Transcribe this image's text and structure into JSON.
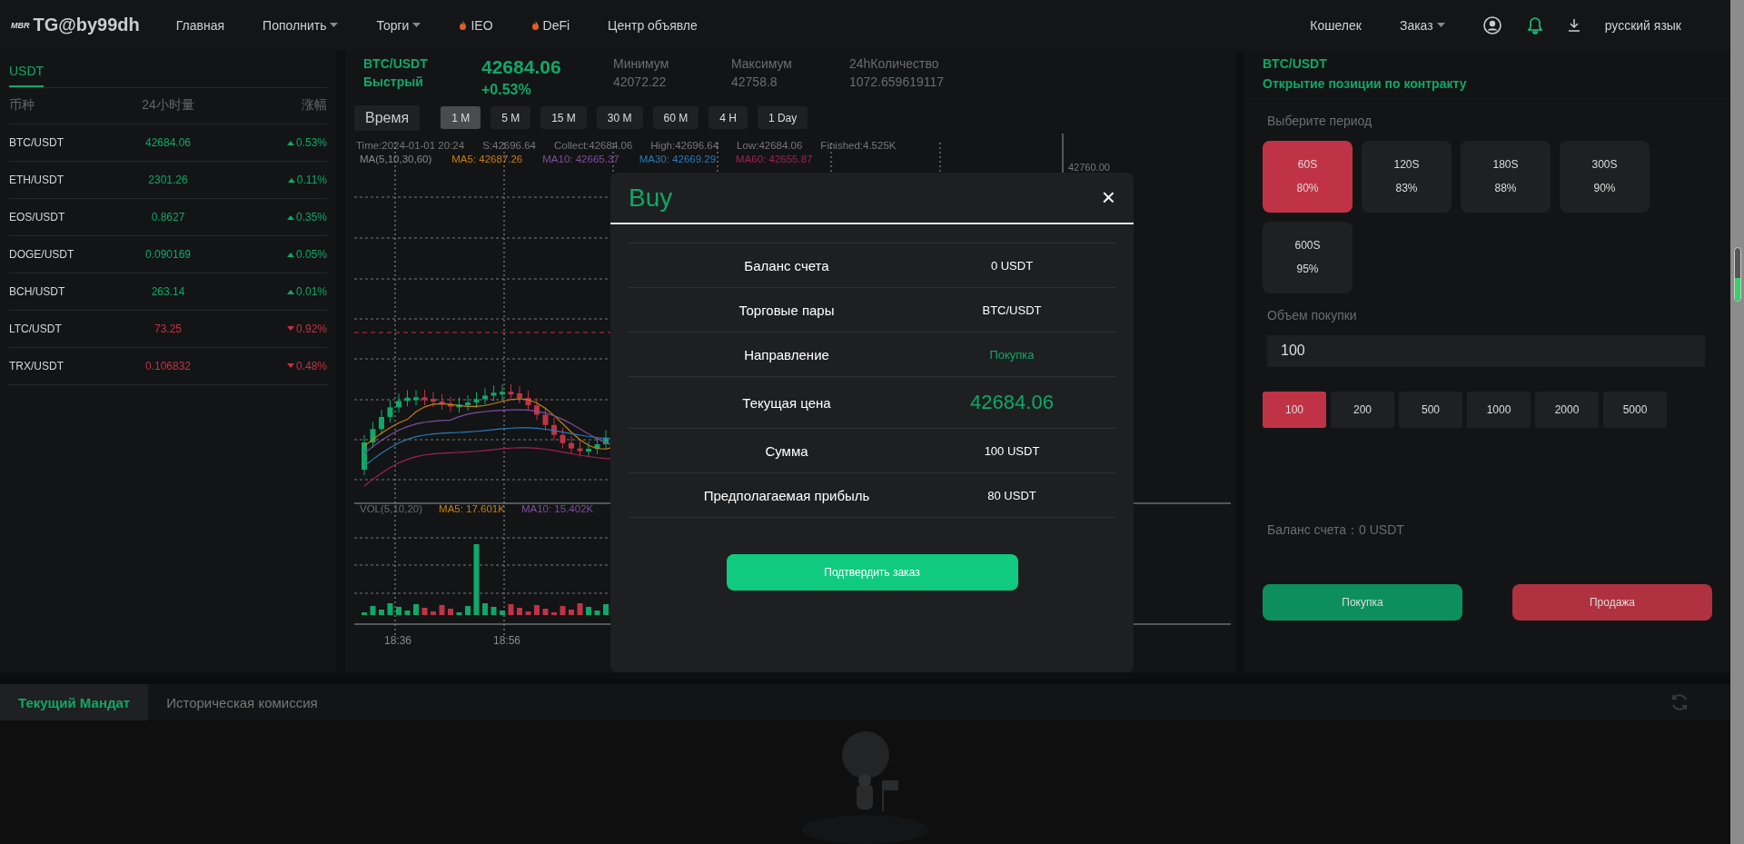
{
  "nav": {
    "logo_mark": "MBR",
    "brand": "TG@by99dh",
    "items": [
      {
        "label": "Главная",
        "kind": "plain"
      },
      {
        "label": "Пополнить",
        "kind": "dropdown"
      },
      {
        "label": "Торги",
        "kind": "dropdown"
      },
      {
        "label": "IEO",
        "kind": "fire"
      },
      {
        "label": "DeFi",
        "kind": "fire"
      },
      {
        "label": "Центр объявле",
        "kind": "plain"
      }
    ],
    "right": [
      {
        "label": "Кошелек",
        "kind": "plain"
      },
      {
        "label": "Заказ",
        "kind": "dropdown"
      },
      {
        "kind": "user"
      },
      {
        "kind": "bell"
      },
      {
        "kind": "download"
      },
      {
        "label": "русский язык",
        "kind": "plain"
      }
    ]
  },
  "market": {
    "tabs": [
      {
        "label": "USDT",
        "selected": true
      }
    ],
    "columns": [
      "币种",
      "24小时量",
      "涨幅"
    ],
    "rows": [
      {
        "pair": "BTC/USDT",
        "price": "42684.06",
        "change": "0.53%",
        "up": true
      },
      {
        "pair": "ETH/USDT",
        "price": "2301.26",
        "change": "0.11%",
        "up": true
      },
      {
        "pair": "EOS/USDT",
        "price": "0.8627",
        "change": "0.35%",
        "up": true
      },
      {
        "pair": "DOGE/USDT",
        "price": "0.090169",
        "change": "0.05%",
        "up": true
      },
      {
        "pair": "BCH/USDT",
        "price": "263.14",
        "change": "0.01%",
        "up": true
      },
      {
        "pair": "LTC/USDT",
        "price": "73.25",
        "change": "0.92%",
        "up": false
      },
      {
        "pair": "TRX/USDT",
        "price": "0.106832",
        "change": "0.48%",
        "up": false
      }
    ]
  },
  "ticker": {
    "pair": "BTC/USDT",
    "mode": "Быстрый",
    "price": "42684.06",
    "change": "+0.53%",
    "stats": [
      {
        "label": "Минимум",
        "value": "42072.22"
      },
      {
        "label": "Максимум",
        "value": "42758.8"
      },
      {
        "label": "24hКоличество",
        "value": "1072.659619117"
      }
    ]
  },
  "chart": {
    "time_label": "Время",
    "intervals": [
      {
        "label": "1 M",
        "selected": true
      },
      {
        "label": "5 M",
        "selected": false
      },
      {
        "label": "15 M",
        "selected": false
      },
      {
        "label": "30 M",
        "selected": false
      },
      {
        "label": "60 M",
        "selected": false
      },
      {
        "label": "4 H",
        "selected": false
      },
      {
        "label": "1 Day",
        "selected": false
      }
    ],
    "info": [
      "Time:2024-01-01 20:24",
      "S:42696.64",
      "Collect:42684.06",
      "High:42696.64",
      "Low:42684.06",
      "Finished:4.525K"
    ],
    "ma": [
      {
        "text": "MA(5,10,30,60)",
        "color": "#8a8a8a"
      },
      {
        "text": "MA5: 42687.26",
        "color": "#c7800d"
      },
      {
        "text": "MA10: 42665.37",
        "color": "#7e4f9c"
      },
      {
        "text": "MA30: 42669.29",
        "color": "#2a7ab8"
      },
      {
        "text": "MA60: 42655.87",
        "color": "#a0234f"
      }
    ],
    "vol": [
      {
        "text": "VOL(5,10,20)",
        "color": "#6a6a6a"
      },
      {
        "text": "MA5: 17.601K",
        "color": "#c7800d"
      },
      {
        "text": "MA10: 15.402K",
        "color": "#7e4f9c"
      }
    ],
    "price_label": "42760.00",
    "times": [
      "18:36",
      "18:56"
    ]
  },
  "order": {
    "pair": "BTC/USDT",
    "subtitle": "Открытие позиции по контракту",
    "period_label": "Выберите период",
    "periods": [
      {
        "time": "60S",
        "rate": "80%",
        "selected": true
      },
      {
        "time": "120S",
        "rate": "83%",
        "selected": false
      },
      {
        "time": "180S",
        "rate": "88%",
        "selected": false
      },
      {
        "time": "300S",
        "rate": "90%",
        "selected": false
      },
      {
        "time": "600S",
        "rate": "95%",
        "selected": false
      }
    ],
    "amount_label": "Объем покупки",
    "amount": "100",
    "presets": [
      {
        "label": "100",
        "selected": true
      },
      {
        "label": "200",
        "selected": false
      },
      {
        "label": "500",
        "selected": false
      },
      {
        "label": "1000",
        "selected": false
      },
      {
        "label": "2000",
        "selected": false
      },
      {
        "label": "5000",
        "selected": false
      }
    ],
    "balance": "Баланс счета：0 USDT",
    "buy": "Покупка",
    "sell": "Продажа"
  },
  "orders": {
    "tabs": [
      {
        "label": "Текущий Мандат",
        "selected": true
      },
      {
        "label": "Историческая комиссия",
        "selected": false
      }
    ]
  },
  "modal": {
    "title": "Buy",
    "close": "×",
    "rows": [
      {
        "label": "Баланс счета",
        "value": "0 USDT",
        "kind": "plain"
      },
      {
        "label": "Торговые пары",
        "value": "BTC/USDT",
        "kind": "plain"
      },
      {
        "label": "Направление",
        "value": "Покупка",
        "kind": "direction"
      },
      {
        "label": "Текущая цена",
        "value": "42684.06",
        "kind": "price"
      },
      {
        "label": "Сумма",
        "value": "100 USDT",
        "kind": "plain"
      },
      {
        "label": "Предполагаемая прибыль",
        "value": "80 USDT",
        "kind": "plain"
      }
    ],
    "confirm": "Подтвердить заказ"
  }
}
